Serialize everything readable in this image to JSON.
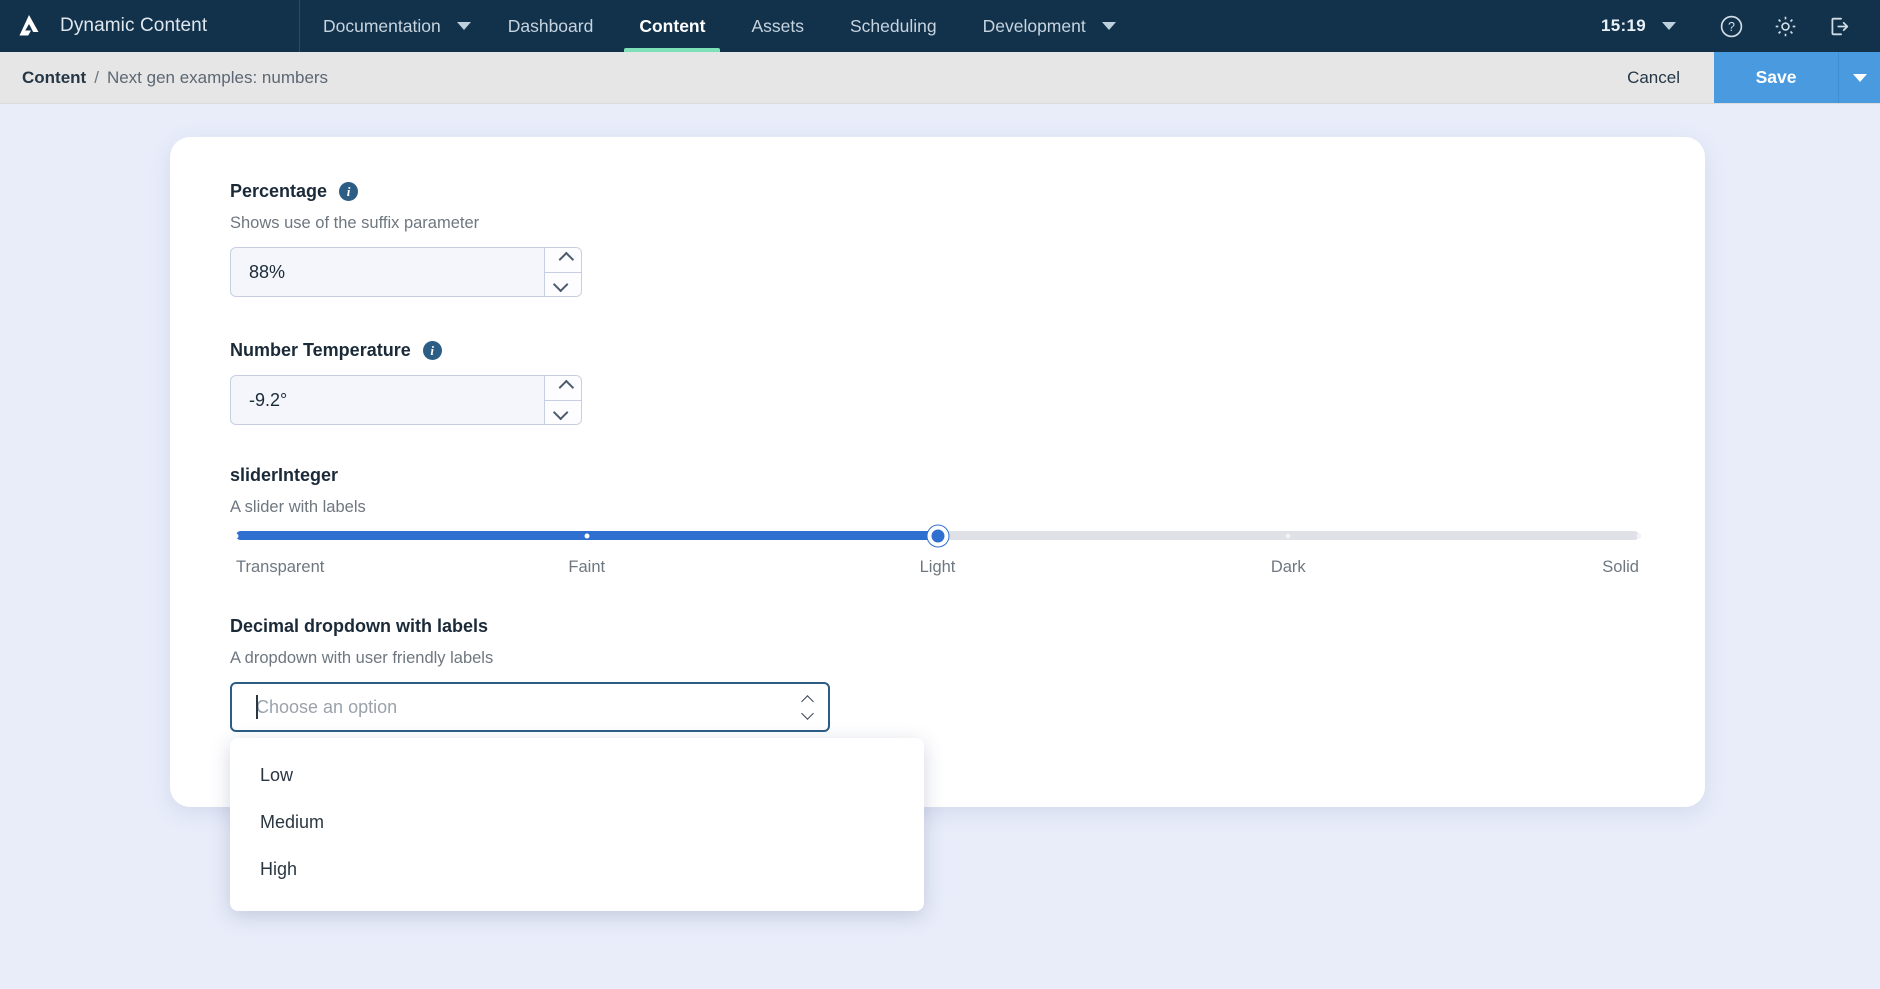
{
  "topnav": {
    "brand": "Dynamic Content",
    "logo_icon": "dynamic-content-logo",
    "items": [
      {
        "label": "Documentation",
        "caret": true,
        "active": false
      },
      {
        "label": "Dashboard",
        "caret": false,
        "active": false
      },
      {
        "label": "Content",
        "caret": false,
        "active": true
      },
      {
        "label": "Assets",
        "caret": false,
        "active": false
      },
      {
        "label": "Scheduling",
        "caret": false,
        "active": false
      },
      {
        "label": "Development",
        "caret": true,
        "active": false
      }
    ],
    "clock": "15:19",
    "help_icon": "help-circle-icon",
    "settings_icon": "gear-icon",
    "logout_icon": "logout-icon",
    "accent_active": "#7ee0b8",
    "background": "#12314b"
  },
  "subbar": {
    "breadcrumb_root": "Content",
    "breadcrumb_separator": "/",
    "breadcrumb_current": "Next gen examples: numbers",
    "cancel_label": "Cancel",
    "save_label": "Save",
    "save_color": "#4a9ae0"
  },
  "form": {
    "percentage": {
      "label": "Percentage",
      "help": "Shows use of the suffix parameter",
      "value": "88%"
    },
    "temperature": {
      "label": "Number Temperature",
      "value": "-9.2°"
    },
    "slider": {
      "label": "sliderInteger",
      "help": "A slider with labels",
      "labels": [
        "Transparent",
        "Faint",
        "Light",
        "Dark",
        "Solid"
      ],
      "value_index": 2,
      "steps": 5,
      "fill_color": "#2f6fd0",
      "track_color": "#dfe1e6"
    },
    "dropdown": {
      "label": "Decimal dropdown with labels",
      "help": "A dropdown with user friendly labels",
      "placeholder": "Choose an option",
      "value": "",
      "open": true,
      "options": [
        "Low",
        "Medium",
        "High"
      ]
    }
  }
}
